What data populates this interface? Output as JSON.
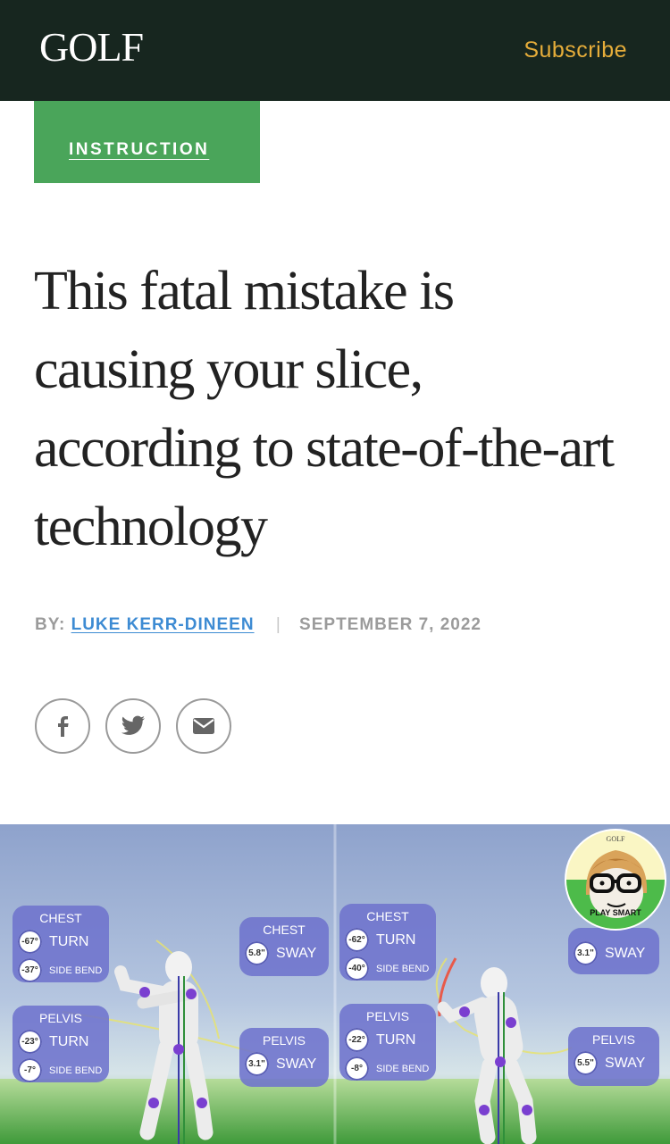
{
  "header": {
    "logo": "GOLF",
    "subscribe_label": "Subscribe"
  },
  "article": {
    "category": "INSTRUCTION",
    "title": "This fatal mistake is causing your slice, according to state-of-the-art technology",
    "byline_prefix": "BY:",
    "author": "LUKE KERR-DINEEN",
    "separator": "|",
    "date": "SEPTEMBER 7, 2022"
  },
  "share": [
    {
      "icon": "facebook-icon"
    },
    {
      "icon": "twitter-icon"
    },
    {
      "icon": "email-icon"
    }
  ],
  "hero": {
    "left": {
      "chest": {
        "title": "CHEST",
        "turn_value": "-67°",
        "turn_label": "TURN",
        "bend_value": "-37°",
        "bend_label": "SIDE BEND"
      },
      "pelvis": {
        "title": "PELVIS",
        "turn_value": "-23°",
        "turn_label": "TURN",
        "bend_value": "-7°",
        "bend_label": "SIDE BEND"
      },
      "chest_sway": {
        "title": "CHEST",
        "value": "5.8\"",
        "label": "SWAY"
      },
      "pelvis_sway": {
        "title": "PELVIS",
        "value": "3.1\"",
        "label": "SWAY"
      }
    },
    "right": {
      "chest": {
        "title": "CHEST",
        "turn_value": "-62°",
        "turn_label": "TURN",
        "bend_value": "-40°",
        "bend_label": "SIDE BEND"
      },
      "pelvis": {
        "title": "PELVIS",
        "turn_value": "-22°",
        "turn_label": "TURN",
        "bend_value": "-8°",
        "bend_label": "SIDE BEND"
      },
      "chest_sway": {
        "value": "3.1\"",
        "label": "SWAY"
      },
      "pelvis_sway": {
        "title": "PELVIS",
        "value": "5.5\"",
        "label": "SWAY"
      }
    },
    "badge": {
      "brand": "GOLF",
      "label": "PLAY SMART"
    }
  },
  "colors": {
    "header_bg": "#17261f",
    "subscribe": "#e6ad3a",
    "tag_bg": "#4aa55a",
    "author_link": "#3d8bd3",
    "panel": "#6e73cd"
  }
}
